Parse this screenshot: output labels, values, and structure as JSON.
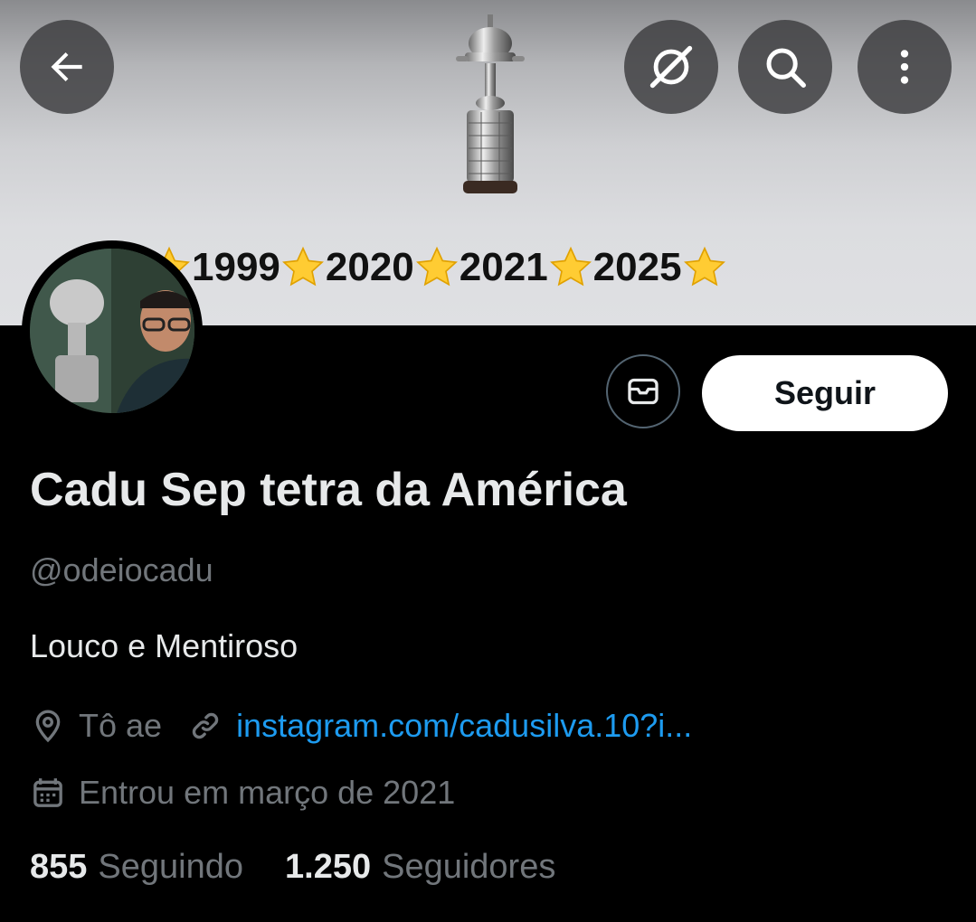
{
  "header": {
    "back_icon": "arrow-left-icon",
    "grok_icon": "grok-icon",
    "search_icon": "search-icon",
    "more_icon": "more-vertical-icon"
  },
  "banner": {
    "years": [
      "1999",
      "2020",
      "2021",
      "2025"
    ],
    "star_icon": "star-emoji",
    "trophy_icon": "trophy-image"
  },
  "actions": {
    "message_icon": "envelope-icon",
    "follow_label": "Seguir"
  },
  "profile": {
    "display_name": "Cadu Sep tetra da América",
    "handle": "@odeiocadu",
    "bio": "Louco e Mentiroso",
    "location": "Tô ae",
    "link": "instagram.com/cadusilva.10?i...",
    "joined": "Entrou em março de 2021"
  },
  "stats": {
    "following_count": "855",
    "following_label": "Seguindo",
    "followers_count": "1.250",
    "followers_label": "Seguidores"
  },
  "colors": {
    "background": "#000000",
    "text_primary": "#e7e9ea",
    "text_secondary": "#71767b",
    "link": "#1d9bf0",
    "follow_bg": "#ffffff"
  }
}
